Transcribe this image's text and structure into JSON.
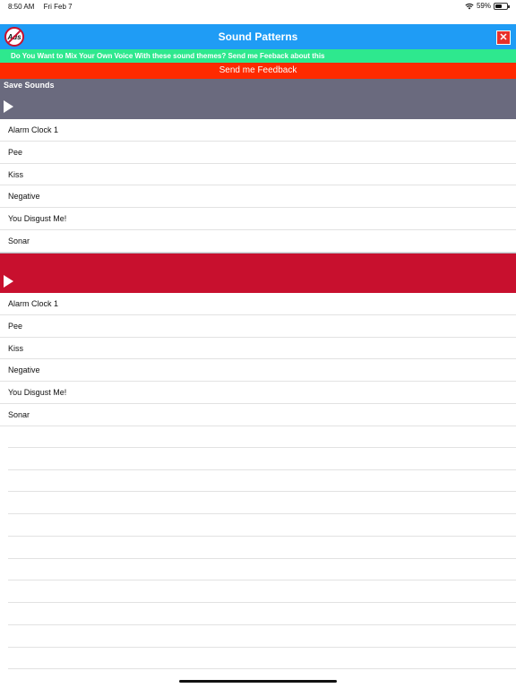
{
  "status": {
    "time": "8:50 AM",
    "date": "Fri Feb 7",
    "battery": "59%",
    "battery_level": 0.59
  },
  "nav": {
    "ads_icon_text": "Ads",
    "title": "Sound Patterns",
    "close_label": "✕"
  },
  "promo_text": "Do You Want to Mix Your Own Voice With these sound themes? Send me Feeback about this",
  "feedback_label": "Send me Feedback",
  "player1": {
    "label": "Save Sounds"
  },
  "list_a": [
    "Alarm Clock 1",
    "Pee",
    "Kiss",
    "Negative",
    "You Disgust Me!",
    "Sonar"
  ],
  "player2": {
    "label": ""
  },
  "list_b": [
    "Alarm Clock 1",
    "Pee",
    "Kiss",
    "Negative",
    "You Disgust Me!",
    "Sonar"
  ],
  "colors": {
    "nav": "#1f9cf5",
    "promo": "#2ee88e",
    "feedback": "#ff2a00",
    "player1": "#6a6a7e",
    "player2": "#c8102e"
  },
  "icons": {
    "ads": "no-ads-icon",
    "close": "close-icon",
    "play": "play-icon",
    "wifi": "wifi-icon",
    "battery": "battery-icon"
  }
}
